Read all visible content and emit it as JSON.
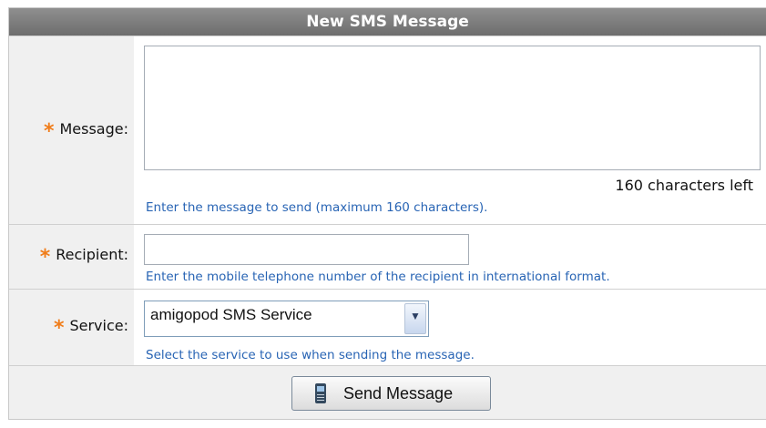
{
  "form": {
    "title": "New SMS Message",
    "message": {
      "required_mark": "*",
      "label": "Message:",
      "value": "",
      "counter": "160 characters left",
      "hint": "Enter the message to send (maximum 160 characters)."
    },
    "recipient": {
      "required_mark": "*",
      "label": "Recipient:",
      "value": "",
      "hint": "Enter the mobile telephone number of the recipient in international format."
    },
    "service": {
      "required_mark": "*",
      "label": "Service:",
      "selected": "amigopod SMS Service",
      "hint": "Select the service to use when sending the message."
    },
    "send_button": {
      "label": "Send Message",
      "icon": "mobile-phone-icon"
    }
  },
  "colors": {
    "title_bar": "#7a7a7a",
    "required_star": "#f07d1a",
    "hint_text": "#2864b4",
    "label_background": "#f0f0f0"
  }
}
